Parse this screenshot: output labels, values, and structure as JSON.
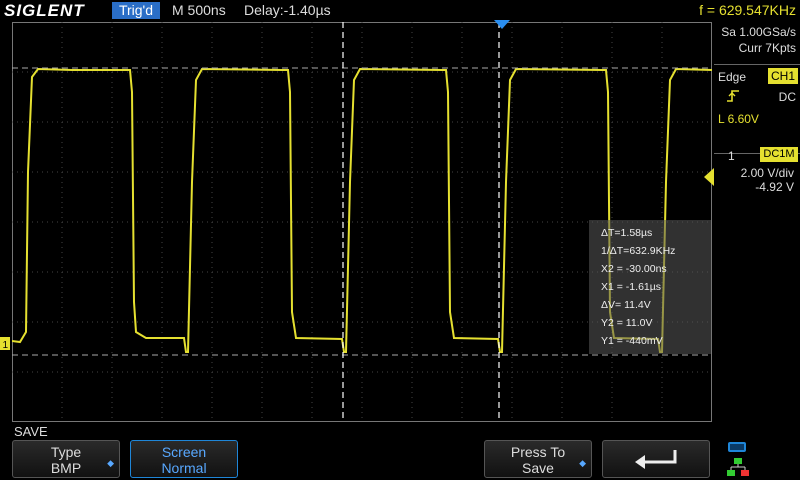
{
  "header": {
    "brand": "SIGLENT",
    "trigger_status": "Trig'd",
    "timebase": "M 500ns",
    "delay": "Delay:-1.40µs",
    "frequency": "f = 629.547KHz"
  },
  "acquisition": {
    "sample_rate": "Sa 1.00GSa/s",
    "memory_depth": "Curr 7Kpts"
  },
  "trigger": {
    "type": "Edge",
    "source": "CH1",
    "coupling": "DC",
    "level": "L  6.60V"
  },
  "channel": {
    "number": "1",
    "coupling_impedance": "DC1M",
    "scale": "2.00 V/div",
    "offset": "-4.92 V"
  },
  "cursor_measurements": {
    "delta_t": "ΔT=1.58µs",
    "inv_delta_t": "1/ΔT=632.9KHz",
    "x2": "X2 = -30.00ns",
    "x1": "X1 = -1.61µs",
    "delta_v": "ΔV= 11.4V",
    "y2": "Y2 = 11.0V",
    "y1": "Y1 = -440mV"
  },
  "menu": {
    "title": "SAVE",
    "type_label": "Type",
    "type_value": "BMP",
    "screen_label": "Screen",
    "screen_value": "Normal",
    "press_label": "Press To",
    "press_value": "Save"
  },
  "colors": {
    "channel1": "#e5e030",
    "accent": "#2a6ec7",
    "cursor": "#ffffff"
  },
  "icons": {
    "return": "return-arrow-icon",
    "usb": "usb-icon",
    "network": "network-icon"
  }
}
